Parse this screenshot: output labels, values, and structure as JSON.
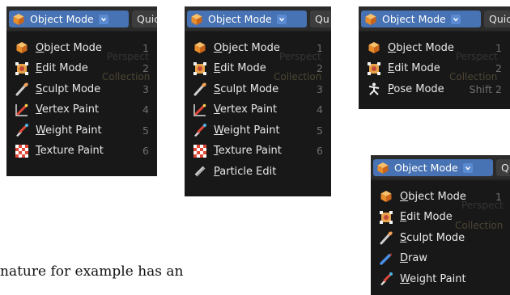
{
  "mode_button": "Object Mode",
  "quick_labels": [
    "Quic",
    "Qu",
    "Quic",
    "Qu"
  ],
  "ghost_text": {
    "perspective": "Perspect",
    "collection": "Collection"
  },
  "menus": {
    "object_menu": [
      {
        "label": "Object Mode",
        "underline": "O",
        "rest": "bject Mode",
        "shortcut": "1",
        "icon": "object-mode-icon"
      },
      {
        "label": "Edit Mode",
        "underline": "E",
        "rest": "dit Mode",
        "shortcut": "2",
        "icon": "edit-mode-icon"
      },
      {
        "label": "Sculpt Mode",
        "underline": "S",
        "rest": "culpt Mode",
        "shortcut": "3",
        "icon": "sculpt-mode-icon"
      },
      {
        "label": "Vertex Paint",
        "underline": "V",
        "rest": "ertex Paint",
        "shortcut": "4",
        "icon": "vertex-paint-icon"
      },
      {
        "label": "Weight Paint",
        "underline": "W",
        "rest": "eight Paint",
        "shortcut": "5",
        "icon": "weight-paint-icon"
      },
      {
        "label": "Texture Paint",
        "underline": "T",
        "rest": "exture Paint",
        "shortcut": "6",
        "icon": "texture-paint-icon"
      }
    ],
    "particle_menu": [
      {
        "label": "Object Mode",
        "underline": "O",
        "rest": "bject Mode",
        "shortcut": "1",
        "icon": "object-mode-icon"
      },
      {
        "label": "Edit Mode",
        "underline": "E",
        "rest": "dit Mode",
        "shortcut": "2",
        "icon": "edit-mode-icon"
      },
      {
        "label": "Sculpt Mode",
        "underline": "S",
        "rest": "culpt Mode",
        "shortcut": "3",
        "icon": "sculpt-mode-icon"
      },
      {
        "label": "Vertex Paint",
        "underline": "V",
        "rest": "ertex Paint",
        "shortcut": "4",
        "icon": "vertex-paint-icon"
      },
      {
        "label": "Weight Paint",
        "underline": "W",
        "rest": "eight Paint",
        "shortcut": "5",
        "icon": "weight-paint-icon"
      },
      {
        "label": "Texture Paint",
        "underline": "T",
        "rest": "exture Paint",
        "shortcut": "6",
        "icon": "texture-paint-icon"
      },
      {
        "label": "Particle Edit",
        "underline": "P",
        "rest": "article Edit",
        "shortcut": "",
        "icon": "particle-edit-icon"
      }
    ],
    "armature_menu": [
      {
        "label": "Object Mode",
        "underline": "O",
        "rest": "bject Mode",
        "shortcut": "1",
        "icon": "object-mode-icon"
      },
      {
        "label": "Edit Mode",
        "underline": "E",
        "rest": "dit Mode",
        "shortcut": "2",
        "icon": "edit-mode-icon"
      },
      {
        "label": "Pose Mode",
        "underline": "P",
        "rest": "ose Mode",
        "shortcut": "Shift 2",
        "icon": "pose-mode-icon"
      }
    ],
    "gpencil_menu": [
      {
        "label": "Object Mode",
        "underline": "O",
        "rest": "bject Mode",
        "shortcut": "1",
        "icon": "object-mode-icon"
      },
      {
        "label": "Edit Mode",
        "underline": "E",
        "rest": "dit Mode",
        "shortcut": "",
        "icon": "edit-mode-icon"
      },
      {
        "label": "Sculpt Mode",
        "underline": "S",
        "rest": "culpt Mode",
        "shortcut": "",
        "icon": "sculpt-mode-icon"
      },
      {
        "label": "Draw",
        "underline": "D",
        "rest": "raw",
        "shortcut": "",
        "icon": "draw-icon"
      },
      {
        "label": "Weight Paint",
        "underline": "W",
        "rest": "eight Paint",
        "shortcut": "",
        "icon": "weight-paint-icon"
      }
    ]
  },
  "caption": "nature for example has an",
  "colors": {
    "accent": "#4772b3",
    "menu_bg": "#181818",
    "header_bg": "#2b2b2b",
    "text": "#e8e8e8",
    "shortcut": "#6f6f6f"
  }
}
